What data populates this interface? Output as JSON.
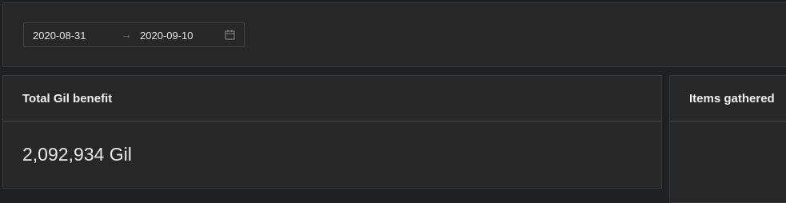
{
  "date_range": {
    "start": "2020-08-31",
    "separator": "→",
    "end": "2020-09-10"
  },
  "cards": {
    "gil": {
      "title": "Total Gil benefit",
      "value": "2,092,934 Gil"
    },
    "items": {
      "title": "Items gathered"
    }
  }
}
